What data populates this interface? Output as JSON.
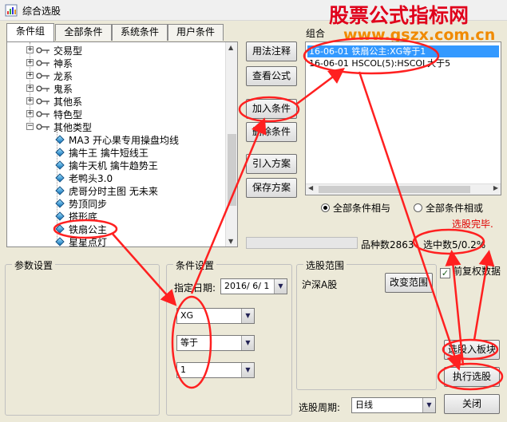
{
  "window": {
    "title": "综合选股"
  },
  "watermark": {
    "name": "股票公式指标网",
    "url": "www.gszx.com.cn"
  },
  "tabs": [
    "条件组",
    "全部条件",
    "系统条件",
    "用户条件"
  ],
  "tree": {
    "categories": [
      "交易型",
      "神系",
      "龙系",
      "鬼系",
      "其他系",
      "特色型",
      "其他类型"
    ],
    "items": [
      "MA3 开心果专用操盘均线",
      "擒牛王 擒牛短线王",
      "擒牛天机 擒牛趋势王",
      "老鸭头3.0",
      "虎哥分时主图 无未来",
      "势顶同步",
      "搭形底",
      "铁扇公主",
      "星星点灯"
    ]
  },
  "buttons": {
    "usage_note": "用法注释",
    "view_formula": "查看公式",
    "add_condition": "加入条件",
    "delete_condition": "删除条件",
    "import_plan": "引入方案",
    "save_plan": "保存方案",
    "change_range": "改变范围",
    "select_to_board": "选股入板块",
    "execute": "执行选股",
    "close": "关闭"
  },
  "combo": {
    "label": "组合",
    "items": [
      "16-06-01 铁扇公主:XG等于1",
      "16-06-01 HSCOL(5):HSCOL大于5"
    ]
  },
  "radios": {
    "and_label": "全部条件相与",
    "or_label": "全部条件相或",
    "selected": "and"
  },
  "status": {
    "done": "选股完毕."
  },
  "counts": {
    "total_label": "品种数",
    "total_value": "2863",
    "selected_label": "选中数",
    "selected_value": "5/0.2%"
  },
  "params": {
    "title": "参数设置"
  },
  "condition_settings": {
    "title": "条件设置",
    "date_label": "指定日期:",
    "date_value": "2016/ 6/ 1",
    "field1": "XG",
    "field2": "等于",
    "field3": "1"
  },
  "range": {
    "title": "选股范围",
    "value": "沪深A股"
  },
  "rights": {
    "label": "前复权数据",
    "checked": true
  },
  "period": {
    "label": "选股周期:",
    "value": "日线"
  }
}
